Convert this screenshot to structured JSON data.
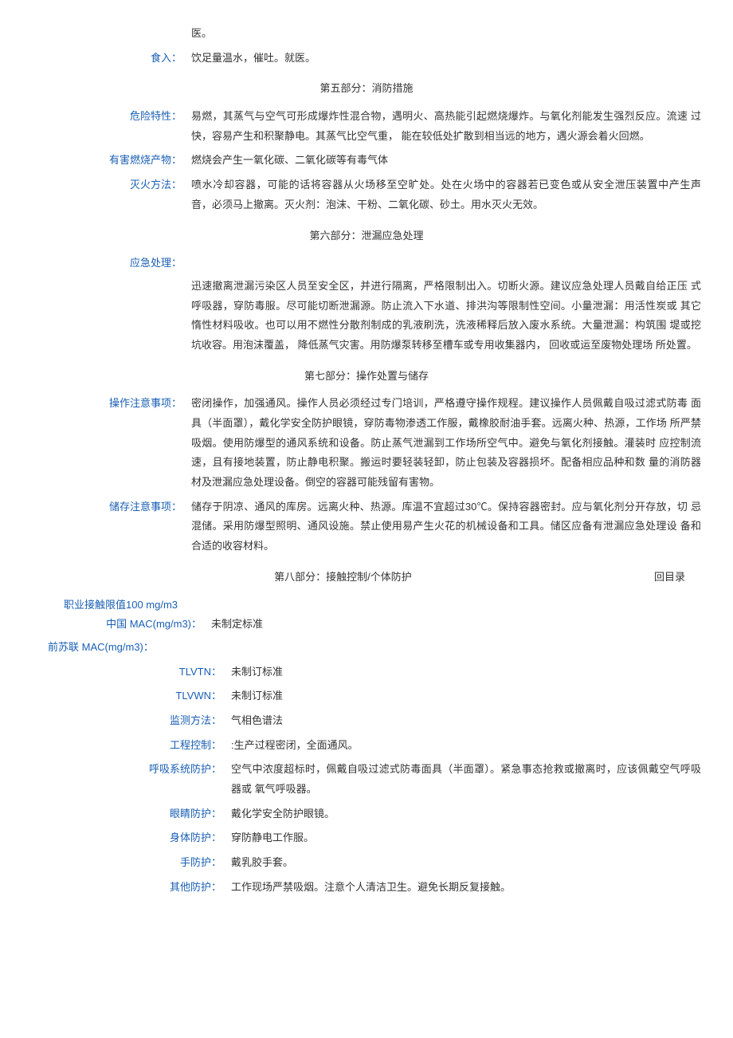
{
  "firstAid": {
    "preContent": "医。",
    "ingestionLabel": "食入：",
    "ingestionContent": "饮足量温水，催吐。就医。"
  },
  "section5": {
    "title": "第五部分：消防措施",
    "hazardLabel": "危险特性：",
    "hazardContent": "易燃，其蒸气与空气可形成爆炸性混合物，遇明火、高热能引起燃烧爆炸。与氧化剂能发生强烈反应。流速 过快，容易产生和积聚静电。其蒸气比空气重， 能在较低处扩散到相当远的地方，遇火源会着火回燃。",
    "combustionLabel": "有害燃烧产物：",
    "combustionContent": "燃烧会产生一氧化碳、二氧化碳等有毒气体",
    "extinguishLabel": "灭火方法：",
    "extinguishContent": "喷水冷却容器，可能的话将容器从火场移至空旷处。处在火场中的容器若已变色或从安全泄压装置中产生声 音，必须马上撤离。灭火剂：泡沫、干粉、二氧化碳、砂土。用水灭火无效。"
  },
  "section6": {
    "title": "第六部分：泄漏应急处理",
    "emergencyLabel": "应急处理：",
    "emergencyContent": "迅速撤离泄漏污染区人员至安全区，并进行隔离，严格限制出入。切断火源。建议应急处理人员戴自给正压 式呼吸器，穿防毒服。尽可能切断泄漏源。防止流入下水道、排洪沟等限制性空间。小量泄漏：用活性炭或 其它惰性材料吸收。也可以用不燃性分散剂制成的乳液刷洗，洗液稀释后放入废水系统。大量泄漏：构筑围 堤或挖坑收容。用泡沫覆盖， 降低蒸气灾害。用防爆泵转移至槽车或专用收集器内， 回收或运至废物处理场 所处置。"
  },
  "section7": {
    "title": "第七部分：操作处置与储存",
    "operationLabel": "操作注意事项：",
    "operationContent": "密闭操作，加强通风。操作人员必须经过专门培训，严格遵守操作规程。建议操作人员佩戴自吸过滤式防毒 面具（半面罩），戴化学安全防护眼镜，穿防毒物渗透工作服，戴橡胶耐油手套。远离火种、热源，工作场 所严禁吸烟。使用防爆型的通风系统和设备。防止蒸气泄漏到工作场所空气中。避免与氧化剂接触。灌装时 应控制流速，且有接地装置，防止静电积聚。搬运时要轻装轻卸，防止包装及容器损坏。配备相应品种和数 量的消防器材及泄漏应急处理设备。倒空的容器可能残留有害物。",
    "storageLabel": "储存注意事项：",
    "storageContent": "储存于阴凉、通风的库房。远离火种、热源。库温不宜超过30℃。保持容器密封。应与氧化剂分开存放，切 忌混储。采用防爆型照明、通风设施。禁止使用易产生火花的机械设备和工具。储区应备有泄漏应急处理设 备和合适的收容材料。"
  },
  "section8": {
    "title": "第八部分：接触控制/个体防护",
    "backLink": "回目录",
    "occupationalLimit": "职业接触限值100 mg/m3",
    "cnMacLabel": "中国  MAC(mg/m3)：",
    "cnMacContent": "未制定标准",
    "formerSovietLabel": "前苏联  MAC(mg/m3)：",
    "tlvtnLabel": "TLVTN：",
    "tlvtnContent": "未制订标准",
    "tlvwnLabel": "TLVWN：",
    "tlvwnContent": "未制订标准",
    "monitorLabel": "监测方法：",
    "monitorContent": "气相色谱法",
    "engControlLabel": "工程控制：",
    "engControlContent": ":生产过程密闭，全面通风。",
    "respiratoryLabel": "呼吸系统防护：",
    "respiratoryContent": "空气中浓度超标时，佩戴自吸过滤式防毒面具（半面罩）。紧急事态抢救或撤离时，应该佩戴空气呼吸器或 氧气呼吸器。",
    "eyeLabel": "眼睛防护：",
    "eyeContent": "戴化学安全防护眼镜。",
    "bodyLabel": "身体防护：",
    "bodyContent": "穿防静电工作服。",
    "handLabel": "手防护：",
    "handContent": "戴乳胶手套。",
    "otherLabel": "其他防护：",
    "otherContent": "工作现场严禁吸烟。注意个人清洁卫生。避免长期反复接触。"
  }
}
